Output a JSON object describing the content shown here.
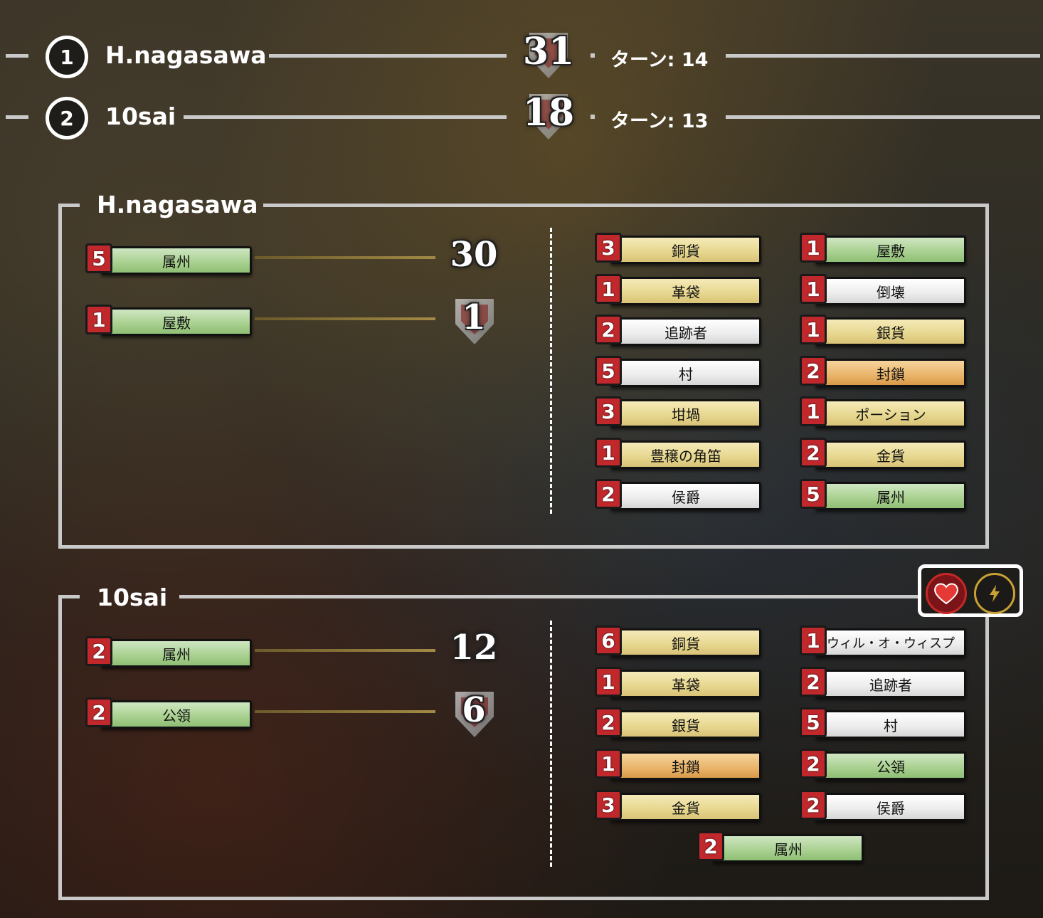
{
  "ranking": [
    {
      "rank": "1",
      "name": "H.nagasawa",
      "score": "31",
      "turn": "ターン: 14"
    },
    {
      "rank": "2",
      "name": "10sai",
      "score": "18",
      "turn": "ターン: 13"
    }
  ],
  "panels": [
    {
      "name": "H.nagasawa",
      "vp": [
        {
          "count": "5",
          "label": "属州",
          "type": "victory",
          "points": "30"
        },
        {
          "count": "1",
          "label": "屋敷",
          "type": "victory",
          "points": "1"
        }
      ],
      "cards_left": [
        {
          "count": "3",
          "label": "銅貨",
          "type": "treasure"
        },
        {
          "count": "1",
          "label": "革袋",
          "type": "treasure"
        },
        {
          "count": "2",
          "label": "追跡者",
          "type": "action"
        },
        {
          "count": "5",
          "label": "村",
          "type": "action"
        },
        {
          "count": "3",
          "label": "坩堝",
          "type": "treasure"
        },
        {
          "count": "1",
          "label": "豊穣の角笛",
          "type": "treasure"
        },
        {
          "count": "2",
          "label": "侯爵",
          "type": "action"
        }
      ],
      "cards_right": [
        {
          "count": "1",
          "label": "屋敷",
          "type": "victory"
        },
        {
          "count": "1",
          "label": "倒壊",
          "type": "action"
        },
        {
          "count": "1",
          "label": "銀貨",
          "type": "treasure"
        },
        {
          "count": "2",
          "label": "封鎖",
          "type": "reaction"
        },
        {
          "count": "1",
          "label": "ポーション",
          "type": "treasure"
        },
        {
          "count": "2",
          "label": "金貨",
          "type": "treasure"
        },
        {
          "count": "5",
          "label": "属州",
          "type": "victory"
        }
      ]
    },
    {
      "name": "10sai",
      "vp": [
        {
          "count": "2",
          "label": "属州",
          "type": "victory",
          "points": "12"
        },
        {
          "count": "2",
          "label": "公領",
          "type": "victory",
          "points": "6"
        }
      ],
      "cards_left": [
        {
          "count": "6",
          "label": "銅貨",
          "type": "treasure"
        },
        {
          "count": "1",
          "label": "革袋",
          "type": "treasure"
        },
        {
          "count": "2",
          "label": "銀貨",
          "type": "treasure"
        },
        {
          "count": "1",
          "label": "封鎖",
          "type": "reaction"
        },
        {
          "count": "3",
          "label": "金貨",
          "type": "treasure"
        }
      ],
      "cards_right": [
        {
          "count": "1",
          "label": "ウィル・オ・ウィスプ",
          "type": "action"
        },
        {
          "count": "2",
          "label": "追跡者",
          "type": "action"
        },
        {
          "count": "5",
          "label": "村",
          "type": "action"
        },
        {
          "count": "2",
          "label": "公領",
          "type": "victory"
        },
        {
          "count": "2",
          "label": "侯爵",
          "type": "action"
        }
      ],
      "cards_bottom": [
        {
          "count": "2",
          "label": "属州",
          "type": "victory"
        }
      ]
    }
  ],
  "icons": {
    "heart": "heart-icon",
    "bolt": "lightning-icon"
  },
  "colors": {
    "count_badge": "#c0282c",
    "treasure": "#e6d68e",
    "victory": "#a8d08f",
    "action": "#ececec",
    "reaction": "#e9b46a"
  }
}
